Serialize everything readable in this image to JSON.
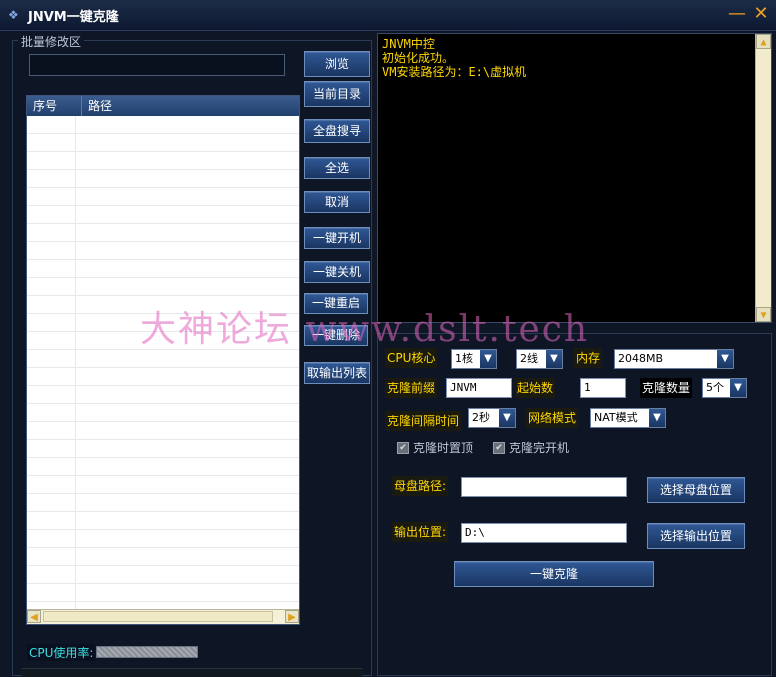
{
  "window": {
    "title": "JNVM一键克隆",
    "minimize": "—",
    "close": "✕"
  },
  "left": {
    "group_label": "批量修改区",
    "path_value": "",
    "list": {
      "col_index": "序号",
      "col_path": "路径",
      "rows": []
    },
    "buttons": {
      "browse": "浏览",
      "current_dir": "当前目录",
      "full_search": "全盘搜寻",
      "select_all": "全选",
      "cancel": "取消",
      "power_on": "一键开机",
      "power_off": "一键关机",
      "restart": "一键重启",
      "delete": "一键删除",
      "get_output": "取输出列表"
    },
    "cpu_label": "CPU使用率:"
  },
  "console": {
    "lines": [
      "JNVM中控",
      "初始化成功。",
      "",
      "VM安装路径为：E:\\虚拟机"
    ]
  },
  "config": {
    "cpu_core_label": "CPU核心",
    "cpu_core_value": "1核",
    "thread_value": "2线",
    "memory_label": "内存",
    "memory_value": "2048MB",
    "prefix_label": "克隆前缀",
    "prefix_value": "JNVM",
    "start_label": "起始数",
    "start_value": "1",
    "count_label": "克隆数量",
    "count_value": "5个",
    "interval_label": "克隆间隔时间",
    "interval_value": "2秒",
    "network_label": "网络模式",
    "network_value": "NAT模式",
    "top_on_clone_label": "克隆时置顶",
    "boot_after_clone_label": "克隆完开机",
    "disk_path_label": "母盘路径:",
    "disk_path_value": "",
    "choose_disk_button": "选择母盘位置",
    "output_label": "输出位置:",
    "output_value": "D:\\",
    "choose_output_button": "选择输出位置",
    "clone_button": "一键克隆"
  },
  "watermark": "大神论坛 www.dslt.tech",
  "colors": {
    "console_text": "#ffd800",
    "button_blue": "#1f3f72",
    "accent_orange": "#f0a020"
  }
}
